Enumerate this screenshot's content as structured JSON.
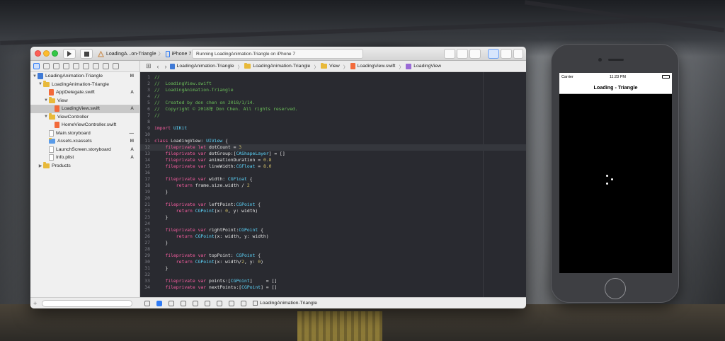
{
  "xcode": {
    "scheme_target": "LoadingA...on-Triangle",
    "device": "iPhone 7",
    "status_text": "Running LoadingAnimation-Triangle on iPhone 7",
    "navigator": {
      "items": [
        {
          "label": "LoadingAnimation-Triangle",
          "badge": "M",
          "kind": "project"
        },
        {
          "label": "LoadingAnimation-Triangle",
          "badge": "",
          "kind": "folder"
        },
        {
          "label": "AppDelegate.swift",
          "badge": "A",
          "kind": "swift"
        },
        {
          "label": "View",
          "badge": "",
          "kind": "folder"
        },
        {
          "label": "LoadingView.swift",
          "badge": "A",
          "kind": "swift"
        },
        {
          "label": "ViewController",
          "badge": "",
          "kind": "folder"
        },
        {
          "label": "HomeViewController.swift",
          "badge": "",
          "kind": "swift"
        },
        {
          "label": "Main.storyboard",
          "badge": "—",
          "kind": "file"
        },
        {
          "label": "Assets.xcassets",
          "badge": "M",
          "kind": "file"
        },
        {
          "label": "LaunchScreen.storyboard",
          "badge": "A",
          "kind": "file"
        },
        {
          "label": "Info.plist",
          "badge": "A",
          "kind": "file"
        },
        {
          "label": "Products",
          "badge": "",
          "kind": "folder"
        }
      ],
      "add_label": "+"
    },
    "jumpbar": {
      "crumbs": [
        "LoadingAnimation-Triangle",
        "LoadingAnimation-Triangle",
        "View",
        "LoadingView.swift",
        "LoadingView"
      ]
    },
    "code": [
      {
        "n": "1",
        "t": "//"
      },
      {
        "n": "2",
        "t": "//  LoadingView.swift"
      },
      {
        "n": "3",
        "t": "//  LoadingAnimation-Triangle"
      },
      {
        "n": "4",
        "t": "//"
      },
      {
        "n": "5",
        "t": "//  Created by don chen on 2018/1/14."
      },
      {
        "n": "6",
        "t": "//  Copyright © 2018年 Don Chen. All rights reserved."
      },
      {
        "n": "7",
        "t": "//"
      },
      {
        "n": "8",
        "t": ""
      },
      {
        "n": "9",
        "t": "import UIKit"
      },
      {
        "n": "10",
        "t": ""
      },
      {
        "n": "11",
        "t": "class LoadingView: UIView {"
      },
      {
        "n": "12",
        "t": "    fileprivate let dotCount = 3"
      },
      {
        "n": "13",
        "t": "    fileprivate var dotGroup:[CAShapeLayer] = []"
      },
      {
        "n": "14",
        "t": "    fileprivate var animationDuration = 0.8"
      },
      {
        "n": "15",
        "t": "    fileprivate var lineWidth:CGFloat = 8.0"
      },
      {
        "n": "16",
        "t": ""
      },
      {
        "n": "17",
        "t": "    fileprivate var width: CGFloat {"
      },
      {
        "n": "18",
        "t": "        return frame.size.width / 2"
      },
      {
        "n": "19",
        "t": "    }"
      },
      {
        "n": "20",
        "t": ""
      },
      {
        "n": "21",
        "t": "    fileprivate var leftPoint:CGPoint {"
      },
      {
        "n": "22",
        "t": "        return CGPoint(x: 0, y: width)"
      },
      {
        "n": "23",
        "t": "    }"
      },
      {
        "n": "24",
        "t": ""
      },
      {
        "n": "25",
        "t": "    fileprivate var rightPoint:CGPoint {"
      },
      {
        "n": "26",
        "t": "        return CGPoint(x: width, y: width)"
      },
      {
        "n": "27",
        "t": "    }"
      },
      {
        "n": "28",
        "t": ""
      },
      {
        "n": "29",
        "t": "    fileprivate var topPoint: CGPoint {"
      },
      {
        "n": "30",
        "t": "        return CGPoint(x: width/2, y: 0)"
      },
      {
        "n": "31",
        "t": "    }"
      },
      {
        "n": "32",
        "t": ""
      },
      {
        "n": "33",
        "t": "    fileprivate var points:[CGPoint]     = []"
      },
      {
        "n": "34",
        "t": "    fileprivate var nextPoints:[CGPoint] = []"
      }
    ],
    "debug_target": "LoadingAnimation-Triangle"
  },
  "simulator": {
    "carrier": "Carrier",
    "time": "11:23 PM",
    "nav_title": "Loading - Triangle"
  },
  "colors": {
    "editor_bg": "#292a30",
    "comment": "#6bbf59",
    "keyword": "#fc5fa3",
    "type": "#5dd8ff",
    "number": "#d0bf69"
  }
}
